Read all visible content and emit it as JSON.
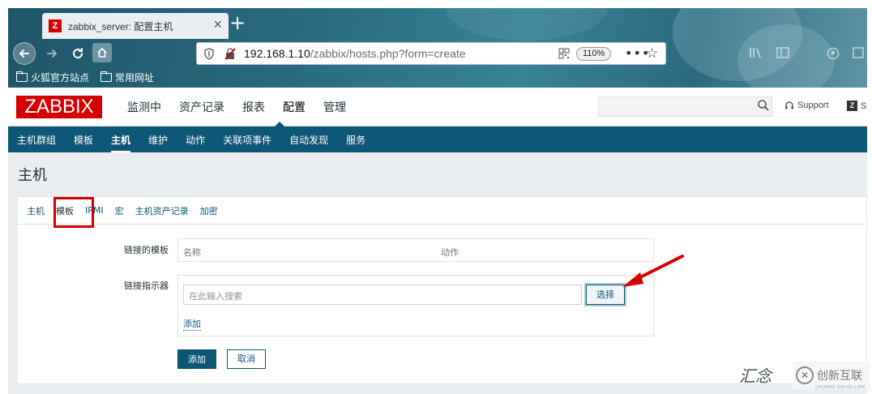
{
  "browser": {
    "tab_title": "zabbix_server: 配置主机",
    "tab_favicon_letter": "Z",
    "new_tab_symbol": "+",
    "url_host": "192.168.1.10",
    "url_path": "/zabbix/hosts.php?form=create",
    "zoom": "110%",
    "bookmarks": [
      "火狐官方站点",
      "常用网址"
    ]
  },
  "header": {
    "logo": "ZABBIX",
    "menu": [
      "监测中",
      "资产记录",
      "报表",
      "配置",
      "管理"
    ],
    "active_menu": "配置",
    "support_label": "Support",
    "share_label": "S"
  },
  "submenu": {
    "items": [
      "主机群组",
      "模板",
      "主机",
      "维护",
      "动作",
      "关联项事件",
      "自动发现",
      "服务"
    ],
    "active": "主机"
  },
  "page": {
    "title": "主机",
    "tabs": [
      "主机",
      "模板",
      "IPMI",
      "宏",
      "主机资产记录",
      "加密"
    ],
    "active_tab": "模板"
  },
  "form": {
    "linked_templates_label": "链接的模板",
    "col_name": "名称",
    "col_action": "动作",
    "link_indicator_label": "链接指示器",
    "search_placeholder": "在此输入搜索",
    "select_button": "选择",
    "add_link": "添加",
    "submit_button": "添加",
    "cancel_button": "取消"
  },
  "watermark": {
    "text": "汇念",
    "brand": "创新互联",
    "brand_sub": "CHUANG XIN HU LIAN"
  },
  "colors": {
    "zabbix_red": "#d40000",
    "zabbix_blue": "#0e5675",
    "annotation_red": "#d40000"
  }
}
